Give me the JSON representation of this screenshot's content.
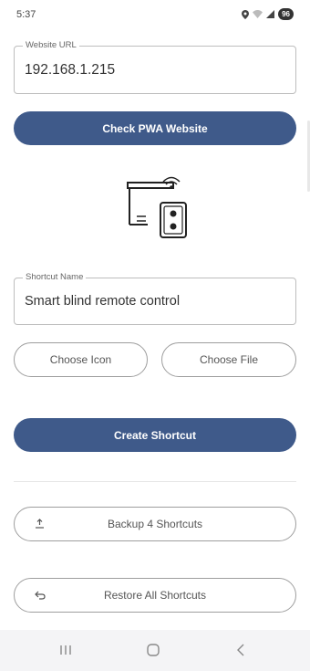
{
  "status_bar": {
    "time": "5:37",
    "battery": "96",
    "icons": [
      "location-icon",
      "wifi-icon",
      "signal-icon",
      "battery-icon"
    ]
  },
  "website_url": {
    "label": "Website URL",
    "value": "192.168.1.215"
  },
  "check_button": {
    "label": "Check PWA Website"
  },
  "shortcut_name": {
    "label": "Shortcut Name",
    "value": "Smart blind remote control"
  },
  "choose_icon": {
    "label": "Choose Icon"
  },
  "choose_file": {
    "label": "Choose File"
  },
  "create_button": {
    "label": "Create Shortcut"
  },
  "backup_button": {
    "label": "Backup 4 Shortcuts",
    "icon": "upload-icon"
  },
  "restore_button": {
    "label": "Restore All Shortcuts",
    "icon": "restore-icon"
  },
  "nav_bar": {
    "icons": [
      "recents-icon",
      "home-icon",
      "back-icon"
    ]
  },
  "colors": {
    "primary": "#3f5a8a",
    "outline": "#9e9e9e",
    "nav_background": "#f4f4f6"
  }
}
